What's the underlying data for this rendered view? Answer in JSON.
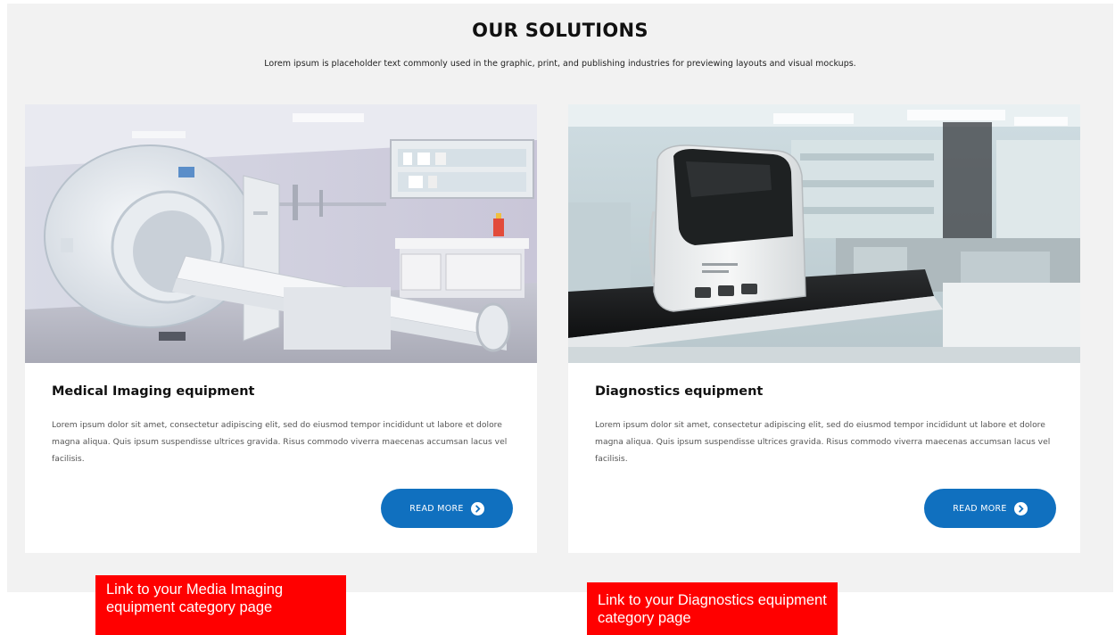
{
  "section": {
    "title": "OUR SOLUTIONS",
    "subtitle": "Lorem ipsum is placeholder text commonly used in the graphic, print, and publishing industries for previewing layouts and visual mockups."
  },
  "cards": [
    {
      "title": "Medical Imaging equipment",
      "body": "Lorem ipsum dolor sit amet, consectetur adipiscing elit, sed do eiusmod tempor incididunt ut labore et dolore magna aliqua. Quis ipsum suspendisse ultrices gravida. Risus commodo viverra maecenas accumsan lacus vel facilisis.",
      "button_label": "READ MORE",
      "note": "Link to your Media Imaging equipment category page"
    },
    {
      "title": "Diagnostics equipment",
      "body": "Lorem ipsum dolor sit amet, consectetur adipiscing elit, sed do eiusmod tempor incididunt ut labore et dolore magna aliqua. Quis ipsum suspendisse ultrices gravida. Risus commodo viverra maecenas accumsan lacus vel facilisis.",
      "button_label": "READ MORE",
      "note": "Link to your Diagnostics equipment category page"
    }
  ],
  "colors": {
    "section_background": "#f2f2f2",
    "button_blue": "#1070bf",
    "annotation_red": "#ff0000"
  },
  "icons": {
    "button_icon": "arrow-right-circle-icon"
  }
}
